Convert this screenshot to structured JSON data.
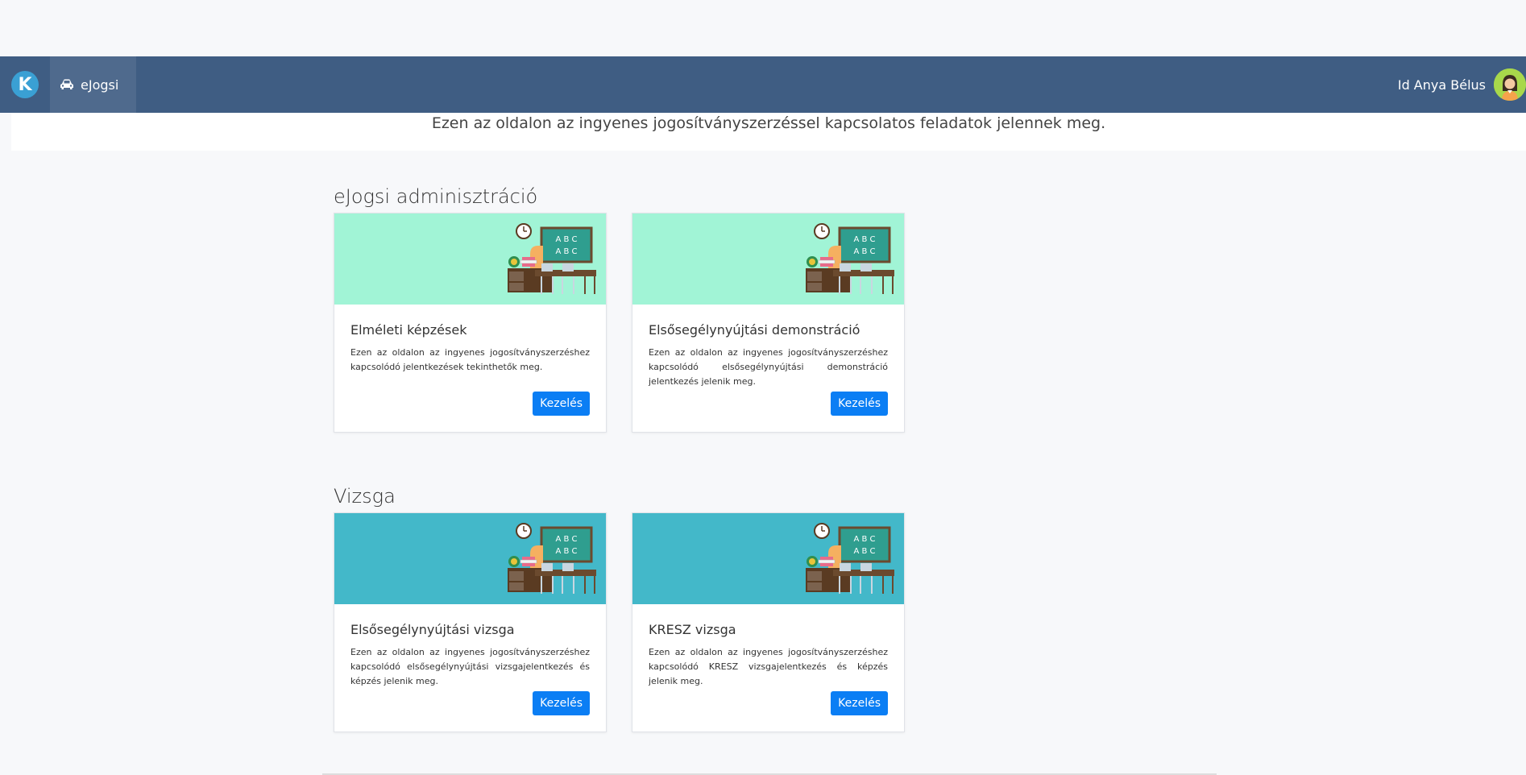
{
  "navbar": {
    "logo_letter": "K",
    "nav_item_label": "eJogsi",
    "user_name": "Id Anya Bélus"
  },
  "intro": {
    "text": "Ezen az oldalon az ingyenes jogosítványszerzéssel kapcsolatos feladatok jelennek meg."
  },
  "sections": [
    {
      "title": "eJogsi adminisztráció",
      "cards": [
        {
          "title": "Elméleti képzések",
          "text": "Ezen az oldalon az ingyenes jogosítványszerzéshez kapcsolódó jelentkezések tekinthetők meg.",
          "button": "Kezelés"
        },
        {
          "title": "Elsősegélynyújtási demonstráció",
          "text": "Ezen az oldalon az ingyenes jogosítványszerzéshez kapcsolódó elsősegélynyújtási demonstráció jelentkezés jelenik meg.",
          "button": "Kezelés"
        }
      ]
    },
    {
      "title": "Vizsga",
      "cards": [
        {
          "title": "Elsősegélynyújtási vizsga",
          "text": "Ezen az oldalon az ingyenes jogosítványszerzéshez kapcsolódó elsősegélynyújtási vizsgajelentkezés és képzés jelenik meg.",
          "button": "Kezelés"
        },
        {
          "title": "KRESZ vizsga",
          "text": "Ezen az oldalon az ingyenes jogosítványszerzéshez kapcsolódó KRESZ vizsgajelentkezés és képzés jelenik meg.",
          "button": "Kezelés"
        }
      ]
    }
  ],
  "illustration": {
    "board_line": "A B C"
  },
  "colors": {
    "navbar": "#3f5d83",
    "card_mint": "#a1f4d6",
    "card_teal": "#43b8c9",
    "button": "#0b7ef4"
  }
}
